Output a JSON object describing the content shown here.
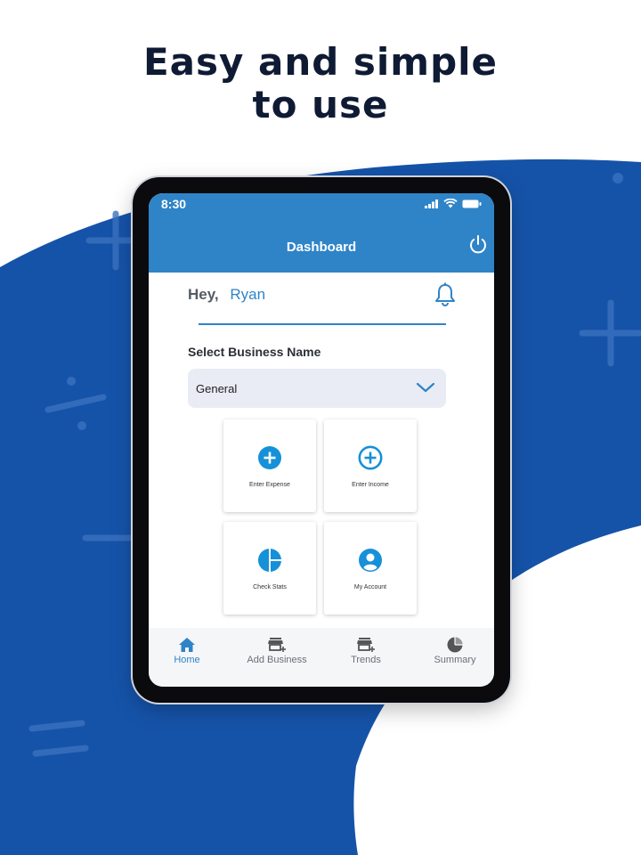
{
  "headline": {
    "line1": "Easy and simple",
    "line2": "to use"
  },
  "status_bar": {
    "time": "8:30"
  },
  "header": {
    "title": "Dashboard",
    "power_icon": "power-icon"
  },
  "greeting": {
    "hey": "Hey,",
    "name": "Ryan",
    "bell_icon": "bell-icon"
  },
  "business": {
    "label": "Select Business Name",
    "selected": "General",
    "chevron_icon": "chevron-down-icon"
  },
  "tiles": [
    {
      "label": "Enter Expense",
      "icon": "plus-circle-filled-icon"
    },
    {
      "label": "Enter Income",
      "icon": "plus-circle-outline-icon"
    },
    {
      "label": "Check Stats",
      "icon": "pie-chart-icon"
    },
    {
      "label": "My Account",
      "icon": "account-icon"
    }
  ],
  "nav": [
    {
      "label": "Home",
      "icon": "home-icon",
      "active": true
    },
    {
      "label": "Add Business",
      "icon": "store-add-icon",
      "active": false
    },
    {
      "label": "Trends",
      "icon": "store-add-icon",
      "active": false
    },
    {
      "label": "Summary",
      "icon": "pie-chart-icon",
      "active": false
    }
  ],
  "colors": {
    "brand": "#2f84c8",
    "wave": "#1553a9",
    "headline": "#0f1b34",
    "icon_blue": "#1690d8"
  }
}
